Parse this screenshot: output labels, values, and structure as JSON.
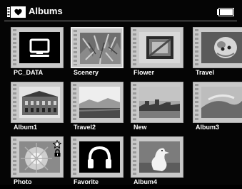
{
  "header": {
    "title": "Albums",
    "album_icon": "album-icon",
    "battery_icon": "battery-icon"
  },
  "albums": [
    {
      "label": "PC_DATA",
      "thumbnail": "monitor-icon"
    },
    {
      "label": "Scenery",
      "thumbnail": "plant-photo",
      "selected": true
    },
    {
      "label": "Flower",
      "thumbnail": "flower-photo"
    },
    {
      "label": "Travel",
      "thumbnail": "animal-photo"
    },
    {
      "label": "Album1",
      "thumbnail": "building-photo"
    },
    {
      "label": "Travel2",
      "thumbnail": "landscape-photo"
    },
    {
      "label": "New",
      "thumbnail": "city-photo"
    },
    {
      "label": "Album3",
      "thumbnail": "rock-photo"
    },
    {
      "label": "Photo",
      "thumbnail": "sunburst-photo",
      "badges": [
        "star-icon",
        "lock-icon"
      ]
    },
    {
      "label": "Favorite",
      "thumbnail": "headphones-icon"
    },
    {
      "label": "Album4",
      "thumbnail": "bird-photo"
    }
  ],
  "colors": {
    "background": "#050505",
    "frame": "#c9c9c9",
    "text": "#ffffff"
  }
}
